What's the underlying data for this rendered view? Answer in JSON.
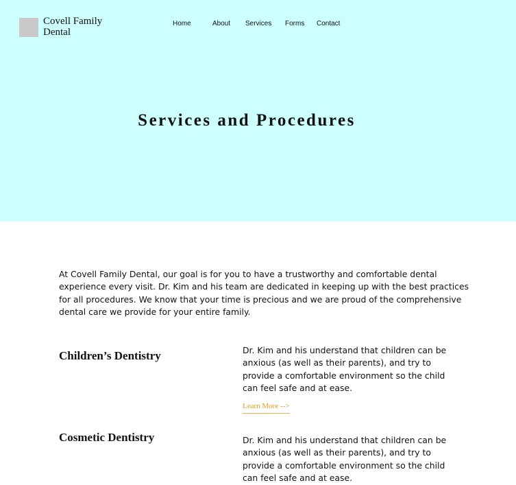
{
  "site": {
    "brand": "Covell Family Dental"
  },
  "nav": {
    "items": [
      {
        "label": "Home"
      },
      {
        "label": "About"
      },
      {
        "label": "Services"
      },
      {
        "label": "Forms"
      },
      {
        "label": "Contact"
      }
    ]
  },
  "hero": {
    "title": "Services and Procedures",
    "background": "#ccfffd"
  },
  "intro": {
    "text": "At Covell Family Dental, our goal is for you to have a trustworthy and comfortable dental experience every visit. Dr. Kim and his team are dedicated in keeping up with the best practices for all procedures. We know that your time is precious and we are proud of the comprehensive dental care we provide for your entire family."
  },
  "services": [
    {
      "title": "Children’s Dentistry",
      "description": "Dr. Kim and his understand that children can be anxious (as well as their parents), and try to provide a comfortable environment so the child can feel safe and at ease.",
      "link_label": "Learn More -->"
    },
    {
      "title": "Cosmetic Dentistry",
      "description": "Dr. Kim and his understand that children can be anxious (as well as their parents), and try to provide a comfortable environment so the child can feel safe and at ease."
    }
  ],
  "colors": {
    "accent": "#e29a1a",
    "logo_placeholder": "#c9c9c9"
  }
}
